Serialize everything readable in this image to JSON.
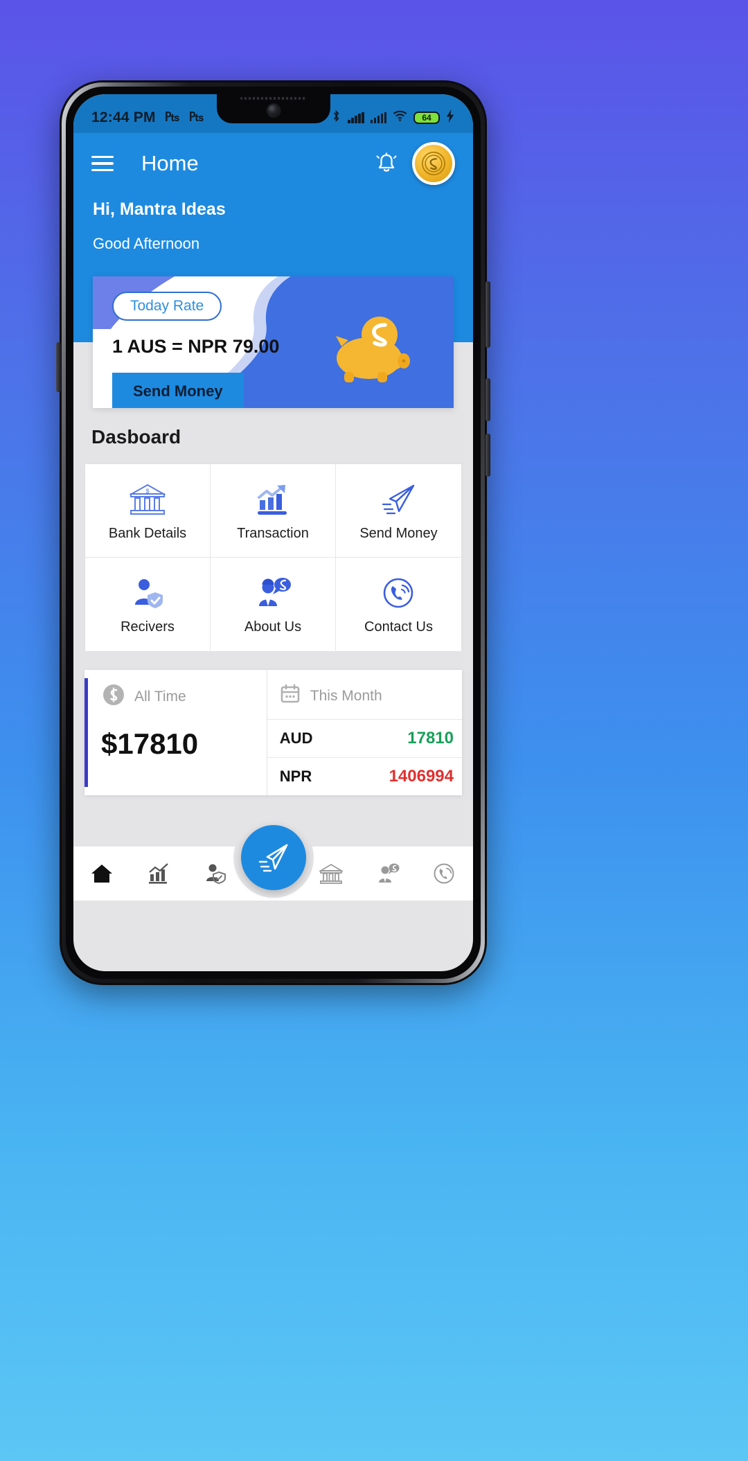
{
  "status_bar": {
    "time": "12:44 PM",
    "left_icons": [
      "p-icon",
      "p-icon"
    ],
    "right_icons": [
      "bluetooth-icon",
      "signal-icon",
      "signal-icon",
      "wifi-icon"
    ],
    "battery_level": "64",
    "battery_color": "#7ee03a",
    "charging": true
  },
  "header": {
    "menu_icon": "hamburger-menu-icon",
    "title": "Home",
    "bell_icon": "notification-bell-icon",
    "avatar_icon": "coin-avatar-icon",
    "background_color": "#1d8ae0"
  },
  "greeting": {
    "name": "Hi, Mantra Ideas",
    "time_of_day": "Good Afternoon"
  },
  "rate_card": {
    "pill_label": "Today Rate",
    "rate_text": "1 AUS = NPR 79.00",
    "button_label": "Send Money",
    "illustration": "piggy-bank-icon",
    "accent_color": "#3f6fe0"
  },
  "dashboard": {
    "title": "Dasboard",
    "tiles": [
      {
        "label": "Bank Details",
        "icon": "bank-icon"
      },
      {
        "label": "Transaction",
        "icon": "bar-chart-icon"
      },
      {
        "label": "Send Money",
        "icon": "paper-plane-icon"
      },
      {
        "label": "Recivers",
        "icon": "user-shield-icon"
      },
      {
        "label": "About Us",
        "icon": "person-speech-dollar-icon"
      },
      {
        "label": "Contact Us",
        "icon": "phone-call-icon"
      }
    ]
  },
  "stats": {
    "all_time": {
      "icon": "dollar-coin-icon",
      "label": "All Time",
      "value": "$17810",
      "accent_color": "#3b3bc9"
    },
    "this_month": {
      "icon": "calendar-icon",
      "label": "This Month",
      "rows": [
        {
          "currency": "AUD",
          "value": "17810",
          "color": "#18a05a"
        },
        {
          "currency": "NPR",
          "value": "1406994",
          "color": "#e03030"
        }
      ]
    }
  },
  "bottom_nav": {
    "items": [
      {
        "icon": "home-icon",
        "active": true
      },
      {
        "icon": "chart-icon",
        "active": false
      },
      {
        "icon": "user-shield-icon",
        "active": false
      },
      {
        "icon": "bank-icon",
        "active": false
      },
      {
        "icon": "person-dollar-icon",
        "active": false
      },
      {
        "icon": "phone-call-icon",
        "active": false
      }
    ],
    "fab_icon": "paper-plane-icon",
    "fab_color": "#1d8ae0"
  }
}
